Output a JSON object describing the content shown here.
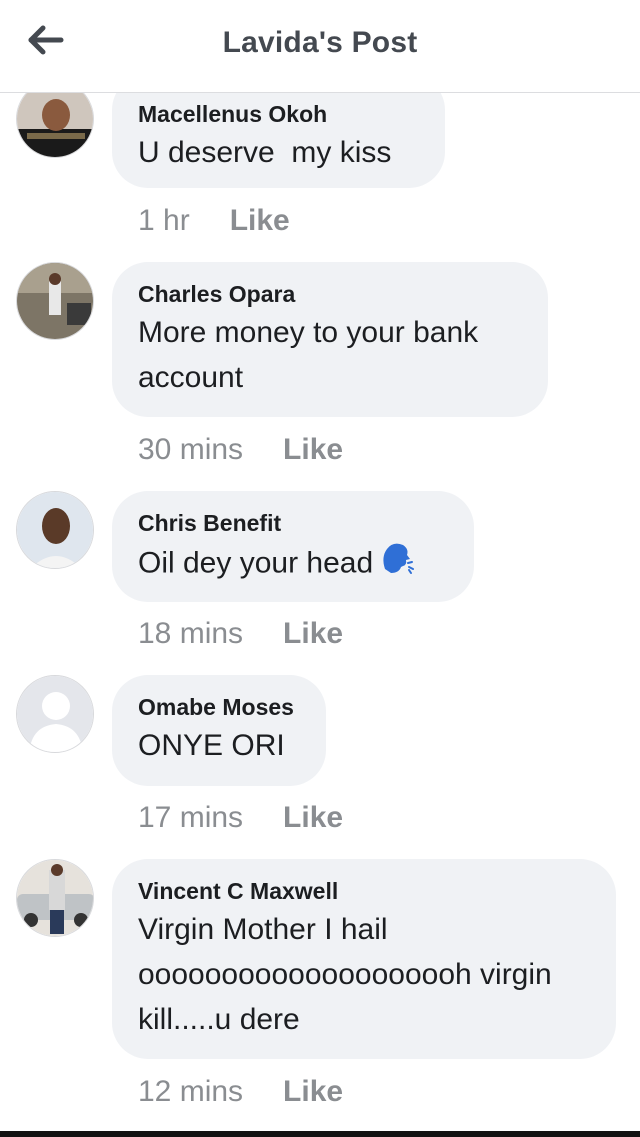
{
  "header": {
    "title": "Lavida's Post",
    "back_icon": "arrow-left-icon"
  },
  "comments": [
    {
      "author": "Macellenus Okoh",
      "text": "U deserve  my kiss",
      "time": "1 hr",
      "like": "Like"
    },
    {
      "author": "Charles Opara",
      "text": "More money to your bank account",
      "time": "30 mins",
      "like": "Like"
    },
    {
      "author": "Chris Benefit",
      "text": "Oil dey your head",
      "emoji": "speaking-head-icon",
      "time": "18 mins",
      "like": "Like"
    },
    {
      "author": "Omabe Moses",
      "text": "ONYE ORI",
      "time": "17 mins",
      "like": "Like"
    },
    {
      "author": "Vincent C Maxwell",
      "text": "Virgin Mother I hail oooooooooooooooooooh virgin kill.....u dere",
      "time": "12 mins",
      "like": "Like"
    }
  ],
  "colors": {
    "bubble": "#f0f2f5",
    "meta_text": "#8a8d91",
    "title_text": "#444950",
    "emoji_blue": "#2f6fd6"
  }
}
